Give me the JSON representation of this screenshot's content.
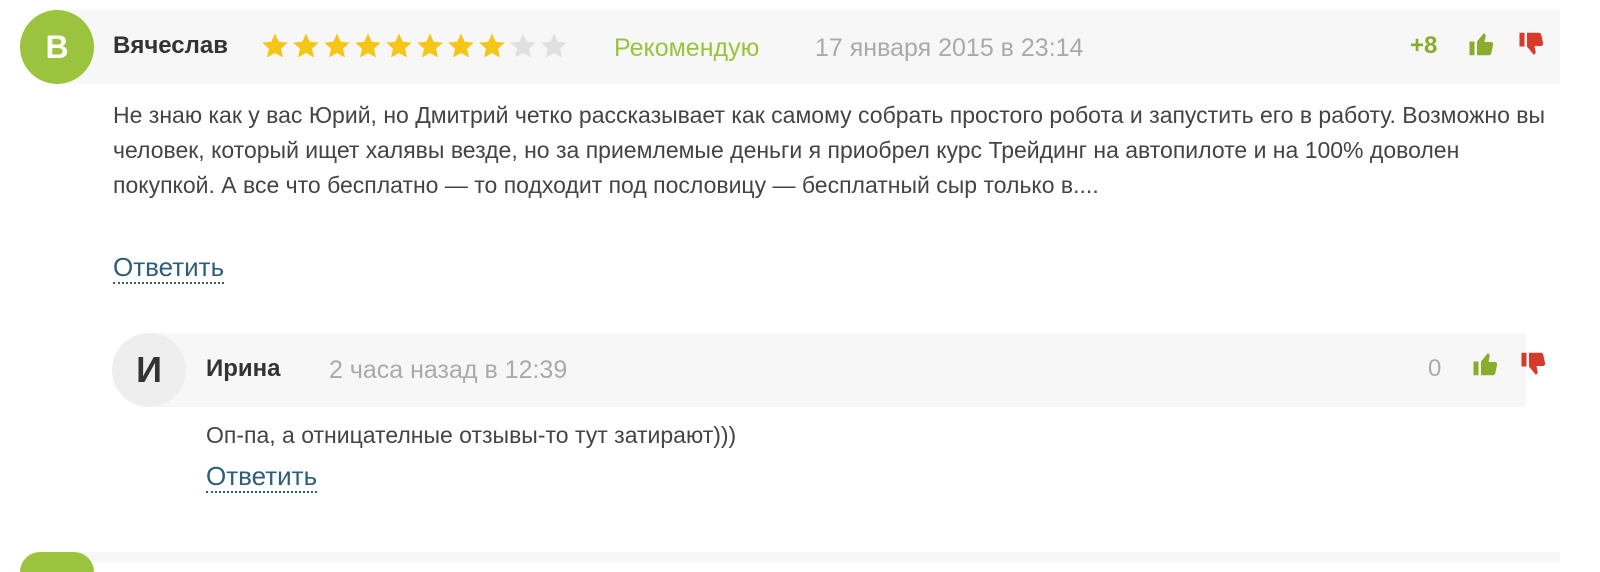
{
  "comments": [
    {
      "avatar_letter": "В",
      "author": "Вячеслав",
      "rating": 8,
      "rating_max": 10,
      "recommend_label": "Рекомендую",
      "date": "17 января 2015 в 23:14",
      "score": "+8",
      "text": "Не знаю как у вас Юрий, но Дмитрий четко рассказывает как самому собрать простого робота и запустить его в работу. Возможно вы человек, который ищет халявы везде, но за приемлемые деньги я приобрел курс Трейдинг на автопилоте и на 100% доволен покупкой. А все что бесплатно — то подходит под пословицу — бесплатный сыр только в....",
      "reply_label": "Ответить"
    },
    {
      "avatar_letter": "И",
      "author": "Ирина",
      "date": "2 часа назад в 12:39",
      "score": "0",
      "text": "Оп-па, а отницателные отзывы-то тут затирают)))",
      "reply_label": "Ответить"
    }
  ],
  "colors": {
    "accent_green": "#9bc33d",
    "score_green": "#8aac2c",
    "dislike_red": "#d63a2a",
    "link_blue": "#2f5e78",
    "star_active": "#f5c518",
    "star_inactive": "#e0e0e0"
  },
  "icons": {
    "like": "thumbs-up-icon",
    "dislike": "thumbs-down-icon",
    "star": "star-icon"
  }
}
